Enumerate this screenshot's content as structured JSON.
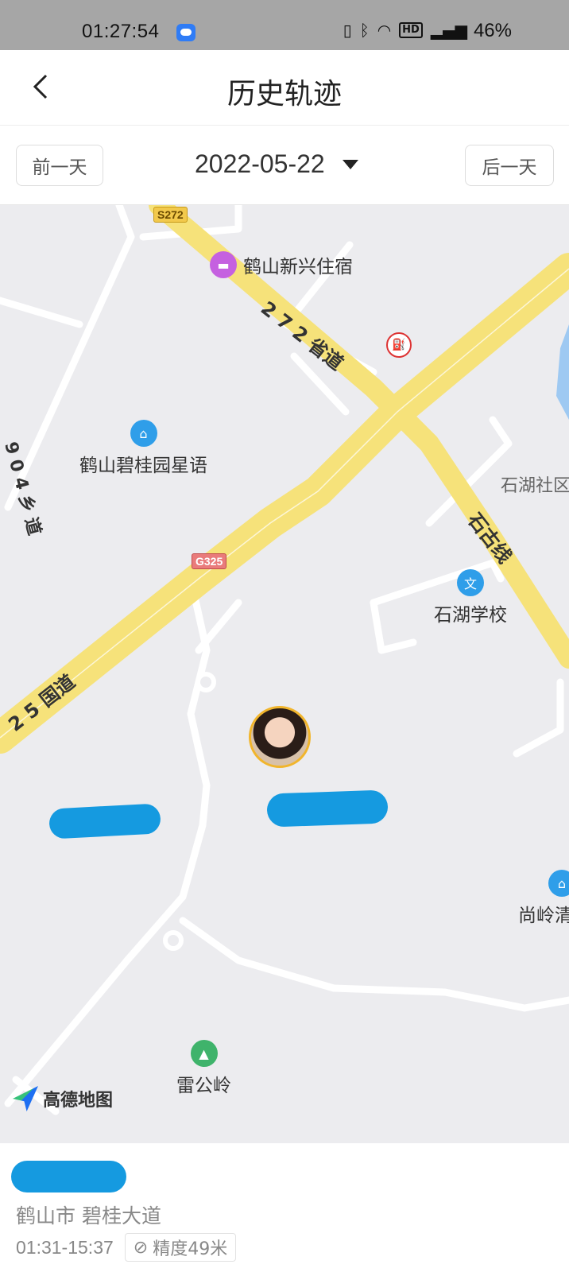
{
  "status_bar": {
    "time": "01:27:54",
    "battery": "46%",
    "icons": [
      "vibrate-icon",
      "bluetooth-icon",
      "wifi-icon",
      "hd-icon",
      "4g-signal-icon"
    ]
  },
  "header": {
    "title": "历史轨迹"
  },
  "date_bar": {
    "prev_label": "前一天",
    "next_label": "后一天",
    "date": "2022-05-22"
  },
  "map": {
    "shield_s272": "S272",
    "shield_g325": "G325",
    "road_272": "2 7 2 省道",
    "road_325": "2 5 国道",
    "road_shigu": "石古线",
    "road_904": "9 0 4 乡 道",
    "pois": {
      "hotel": "鹤山新兴住宿",
      "residence": "鹤山碧桂园星语",
      "community": "石湖社区",
      "school": "石湖学校",
      "shangling": "尚岭清",
      "leigongling": "雷公岭"
    },
    "provider": "高德地图",
    "colors": {
      "road_main": "#f6e27a",
      "background": "#ececef",
      "accent": "#159ae0"
    }
  },
  "footer": {
    "address": "鹤山市 碧桂大道",
    "time_range": "01:31-15:37",
    "accuracy": "精度49米"
  }
}
